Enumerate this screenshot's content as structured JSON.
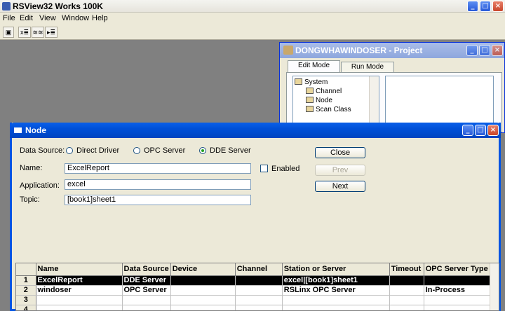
{
  "app": {
    "title": "RSView32 Works 100K",
    "menu": [
      "File",
      "Edit",
      "View",
      "Window",
      "Help"
    ],
    "toolbar": [
      "x≣",
      "≋≋",
      "▸≣"
    ]
  },
  "project": {
    "title": "DONGWHAWINDOSER - Project",
    "tabs": [
      "Edit Mode",
      "Run Mode"
    ],
    "tree": [
      "System",
      "Channel",
      "Node",
      "Scan Class"
    ]
  },
  "node": {
    "title": "Node",
    "data_source_label": "Data Source:",
    "sources": [
      "Direct Driver",
      "OPC Server",
      "DDE Server"
    ],
    "selected_source": "DDE Server",
    "name_label": "Name:",
    "name_value": "ExcelReport",
    "enabled_label": "Enabled",
    "application_label": "Application:",
    "application_value": "excel",
    "topic_label": "Topic:",
    "topic_value": "[book1]sheet1",
    "buttons": {
      "close": "Close",
      "prev": "Prev",
      "next": "Next"
    },
    "table": {
      "headers": [
        "Name",
        "Data Source",
        "Device",
        "Channel",
        "Station or Server",
        "Timeout",
        "OPC Server Type"
      ],
      "rows": [
        {
          "num": "1",
          "cells": [
            "ExcelReport",
            "DDE Server",
            "",
            "",
            "excel|[book1]sheet1",
            "",
            ""
          ]
        },
        {
          "num": "2",
          "cells": [
            "windoser",
            "OPC Server",
            "",
            "",
            "RSLinx OPC Server",
            "",
            "In-Process"
          ]
        },
        {
          "num": "3",
          "cells": [
            "",
            "",
            "",
            "",
            "",
            "",
            ""
          ]
        },
        {
          "num": "4",
          "cells": [
            "",
            "",
            "",
            "",
            "",
            "",
            ""
          ]
        }
      ]
    }
  }
}
